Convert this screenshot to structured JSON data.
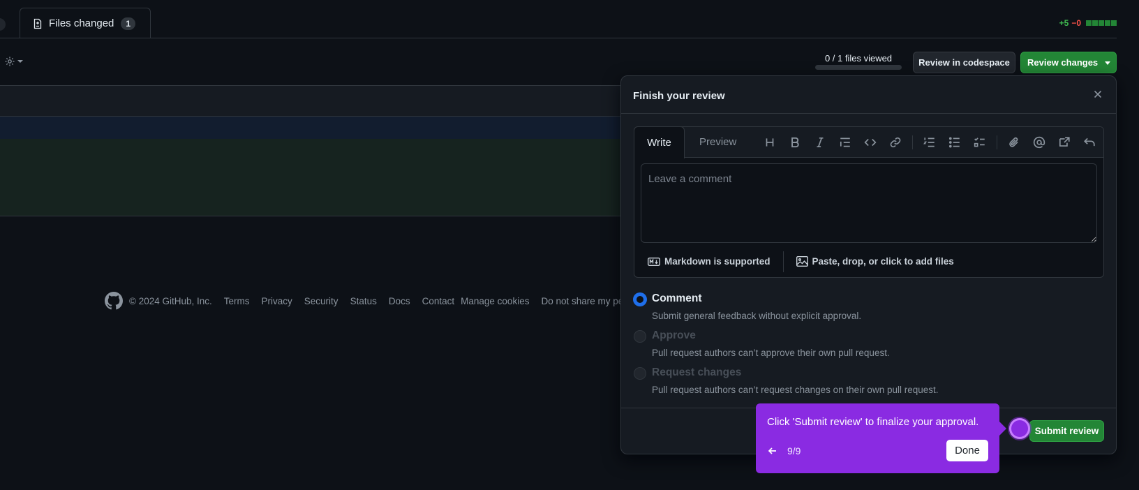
{
  "tabs": {
    "files_changed_label": "Files changed",
    "files_changed_count": "1"
  },
  "diffstat": {
    "additions": "+5",
    "deletions": "−0"
  },
  "toolbar": {
    "files_viewed": "0 / 1 files viewed",
    "files_viewed_progress": 0,
    "review_in_codespace": "Review in codespace",
    "review_changes": "Review changes"
  },
  "footer": {
    "copyright": "© 2024 GitHub, Inc.",
    "links": [
      "Terms",
      "Privacy",
      "Security",
      "Status",
      "Docs",
      "Contact",
      "Manage cookies",
      "Do not share my perso"
    ]
  },
  "review_panel": {
    "title": "Finish your review",
    "editor": {
      "write_tab": "Write",
      "preview_tab": "Preview",
      "placeholder": "Leave a comment",
      "markdown_note": "Markdown is supported",
      "attach_note": "Paste, drop, or click to add files"
    },
    "options": [
      {
        "label": "Comment",
        "description": "Submit general feedback without explicit approval.",
        "selected": true,
        "disabled": false
      },
      {
        "label": "Approve",
        "description": "Pull request authors can’t approve their own pull request.",
        "selected": false,
        "disabled": true
      },
      {
        "label": "Request changes",
        "description": "Pull request authors can’t request changes on their own pull request.",
        "selected": false,
        "disabled": true
      }
    ],
    "submit_label": "Submit review"
  },
  "tour": {
    "message": "Click 'Submit review' to finalize your approval.",
    "step": "9/9",
    "done_label": "Done",
    "color": "#8a2be2"
  },
  "colors": {
    "background": "#0d1117",
    "accent_green": "#238636",
    "accent_blue": "#1f6feb"
  }
}
